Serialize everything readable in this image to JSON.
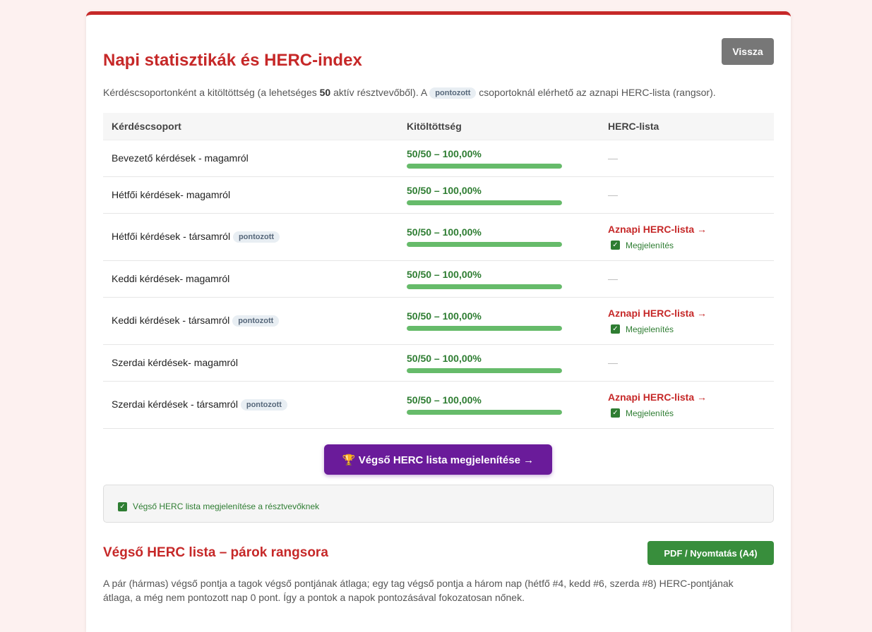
{
  "header": {
    "title": "Napi statisztikák és HERC-index",
    "back_label": "Vissza"
  },
  "intro": {
    "text1": "Kérdéscsoportonként a kitöltöttség (a lehetséges ",
    "count": "50",
    "text2": " aktív résztvevőből). A ",
    "pill": "pontozott",
    "text3": " csoportoknál elérhető az aznapi HERC-lista (rangsor)."
  },
  "table": {
    "headers": [
      "Kérdéscsoport",
      "Kitöltöttség",
      "HERC-lista"
    ],
    "rows": [
      {
        "name": "Bevezető kérdések - magamról",
        "pill": "",
        "fill": "50/50 – 100,00%",
        "fraction": 1.0,
        "herc": "—",
        "show": ""
      },
      {
        "name": "Hétfői kérdések- magamról",
        "pill": "",
        "fill": "50/50 – 100,00%",
        "fraction": 1.0,
        "herc": "—",
        "show": ""
      },
      {
        "name": "Hétfői kérdések - társamról",
        "pill": "pontozott",
        "fill": "50/50 – 100,00%",
        "fraction": 1.0,
        "herc": "Aznapi HERC-lista →",
        "show": "Megjelenítés"
      },
      {
        "name": "Keddi kérdések- magamról",
        "pill": "",
        "fill": "50/50 – 100,00%",
        "fraction": 1.0,
        "herc": "—",
        "show": ""
      },
      {
        "name": "Keddi kérdések - társamról",
        "pill": "pontozott",
        "fill": "50/50 – 100,00%",
        "fraction": 1.0,
        "herc": "Aznapi HERC-lista →",
        "show": "Megjelenítés"
      },
      {
        "name": "Szerdai kérdések- magamról",
        "pill": "",
        "fill": "50/50 – 100,00%",
        "fraction": 1.0,
        "herc": "—",
        "show": ""
      },
      {
        "name": "Szerdai kérdések - társamról",
        "pill": "pontozott",
        "fill": "50/50 – 100,00%",
        "fraction": 1.0,
        "herc": "Aznapi HERC-lista →",
        "show": "Megjelenítés"
      }
    ]
  },
  "final": {
    "button_label": "🏆 Végső HERC lista megjelenítése →",
    "checkbox_label": "Végső HERC lista megjelenítése a résztvevőknek"
  },
  "ranking": {
    "title": "Végső HERC lista – párok rangsora",
    "pdf_label": "PDF / Nyomtatás (A4)",
    "note": "A pár (hármas) végső pontja a tagok végső pontjának átlaga; egy tag végső pontja a három nap (hétfő #4, kedd #6, szerda #8) HERC-pontjának átlaga, a még nem pontozott nap 0 pont. Így a pontok a napok pontozásával fokozatosan nőnek."
  },
  "colors": {
    "accent": "#c62828",
    "progress": "#66bb6a",
    "final_button": "#6a1b9a",
    "pdf_button": "#388e3c"
  }
}
